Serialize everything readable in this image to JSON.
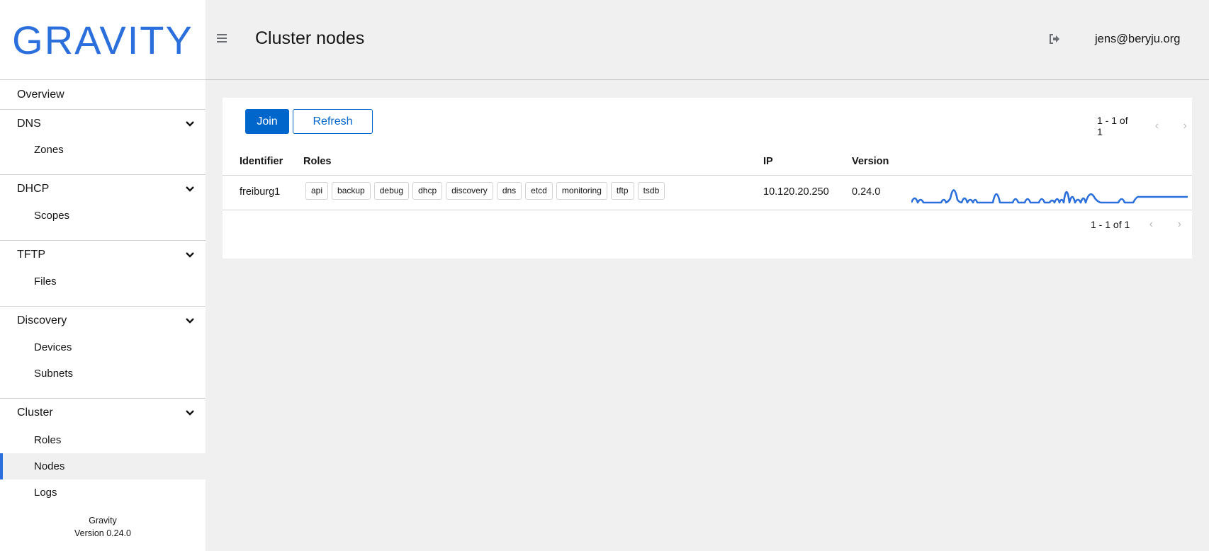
{
  "app": {
    "logo_text": "GRAVITY",
    "footer_name": "Gravity",
    "footer_version": "Version 0.24.0"
  },
  "sidebar": {
    "overview": "Overview",
    "groups": [
      {
        "label": "DNS",
        "items": [
          "Zones"
        ]
      },
      {
        "label": "DHCP",
        "items": [
          "Scopes"
        ]
      },
      {
        "label": "TFTP",
        "items": [
          "Files"
        ]
      },
      {
        "label": "Discovery",
        "items": [
          "Devices",
          "Subnets"
        ]
      },
      {
        "label": "Cluster",
        "items": [
          "Roles",
          "Nodes",
          "Logs"
        ]
      }
    ],
    "active_item": "Nodes"
  },
  "header": {
    "title": "Cluster nodes",
    "user": "jens@beryju.org"
  },
  "toolbar": {
    "join_label": "Join",
    "refresh_label": "Refresh",
    "pagination_top": "1 - 1 of 1",
    "pagination_bottom": "1 - 1 of 1"
  },
  "table": {
    "columns": [
      "Identifier",
      "Roles",
      "IP",
      "Version"
    ],
    "rows": [
      {
        "identifier": "freiburg1",
        "roles": [
          "api",
          "backup",
          "debug",
          "dhcp",
          "discovery",
          "dns",
          "etcd",
          "monitoring",
          "tftp",
          "tsdb"
        ],
        "ip": "10.120.20.250",
        "version": "0.24.0"
      }
    ]
  },
  "colors": {
    "accent": "#2b6fdc",
    "primary_button": "#0066cc",
    "sparkline": "#2b6fdc"
  },
  "icons": {
    "menu": "hamburger-icon",
    "logout": "logout-icon",
    "chevron": "chevron-down-icon",
    "prev": "chevron-left-icon",
    "next": "chevron-right-icon"
  }
}
